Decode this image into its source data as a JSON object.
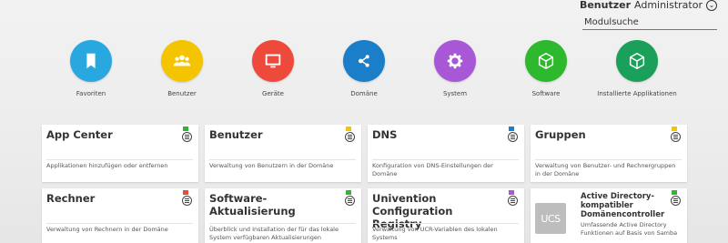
{
  "header": {
    "user_label": "Benutzer",
    "user_name": "Administrator",
    "search_placeholder": "Modulsuche"
  },
  "categories": [
    {
      "label": "Favoriten",
      "color": "#29a8e0",
      "icon": "bookmark-icon"
    },
    {
      "label": "Benutzer",
      "color": "#f5c400",
      "icon": "users-icon"
    },
    {
      "label": "Geräte",
      "color": "#ee4a3c",
      "icon": "monitor-icon"
    },
    {
      "label": "Domäne",
      "color": "#1b7ec9",
      "icon": "network-icon"
    },
    {
      "label": "System",
      "color": "#a857d6",
      "icon": "gear-icon"
    },
    {
      "label": "Software",
      "color": "#2db82d",
      "icon": "box-icon"
    },
    {
      "label": "Installierte Applikationen",
      "color": "#1aa05a",
      "icon": "box-icon"
    }
  ],
  "tiles": [
    {
      "title": "App Center",
      "desc": "Applikationen hinzufügen oder entfernen",
      "flag": "#2db82d"
    },
    {
      "title": "Benutzer",
      "desc": "Verwaltung von Benutzern in der Domäne",
      "flag": "#f5c400"
    },
    {
      "title": "DNS",
      "desc": "Konfiguration von DNS-Einstellungen der Domäne",
      "flag": "#1b7ec9"
    },
    {
      "title": "Gruppen",
      "desc": "Verwaltung von Benutzer- und Rechnergruppen in der Domäne",
      "flag": "#f5c400"
    },
    {
      "title": "Rechner",
      "desc": "Verwaltung von Rechnern in der Domäne",
      "flag": "#ee4a3c"
    },
    {
      "title": "Software-Aktualisierung",
      "desc": "Überblick und Installation der für das lokale System verfügbaren Aktualisierungen",
      "flag": "#2db82d"
    },
    {
      "title": "Univention Configuration Registry",
      "desc": "Verwaltung von UCR-Variablen des lokalen Systems",
      "flag": "#a857d6"
    },
    {
      "title": "Active Directory-kompatibler Domänencontroller",
      "desc": "Umfassende Active Directory Funktionen auf Basis von Samba",
      "flag": "#2db82d",
      "logo": "UCS"
    }
  ]
}
